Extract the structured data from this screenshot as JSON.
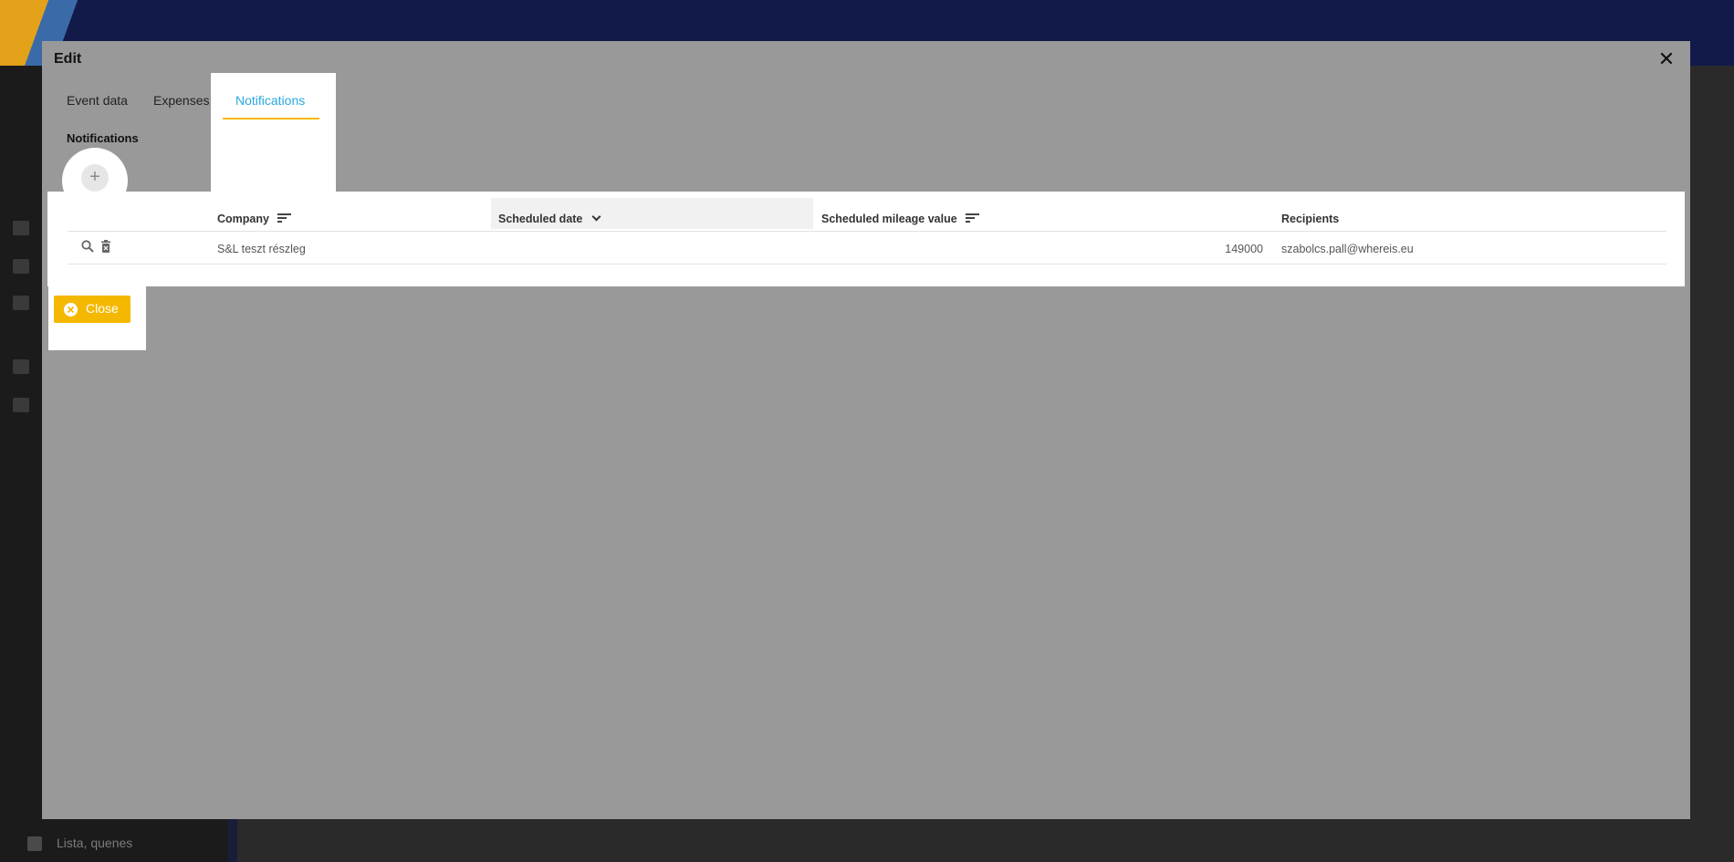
{
  "background": {
    "bottom_item_label": "Lista, quenes"
  },
  "modal": {
    "title": "Edit",
    "tabs": [
      {
        "label": "Event data"
      },
      {
        "label": "Expenses"
      },
      {
        "label": "Notifications",
        "active": true
      }
    ],
    "section_title": "Notifications",
    "table": {
      "columns": [
        {
          "label": "Company",
          "sort": "none"
        },
        {
          "label": "Scheduled date",
          "sort": "desc"
        },
        {
          "label": "Scheduled mileage value",
          "sort": "none"
        },
        {
          "label": "Recipients",
          "sort": null
        }
      ],
      "rows": [
        {
          "company": "S&L teszt részleg",
          "scheduled_date": "",
          "scheduled_mileage_value": "149000",
          "recipients": "szabolcs.pall@whereis.eu"
        }
      ]
    },
    "close_label": "Close"
  },
  "colors": {
    "accent": "#f5b800",
    "tab_active": "#29a8e0",
    "overlay": "#999999"
  }
}
